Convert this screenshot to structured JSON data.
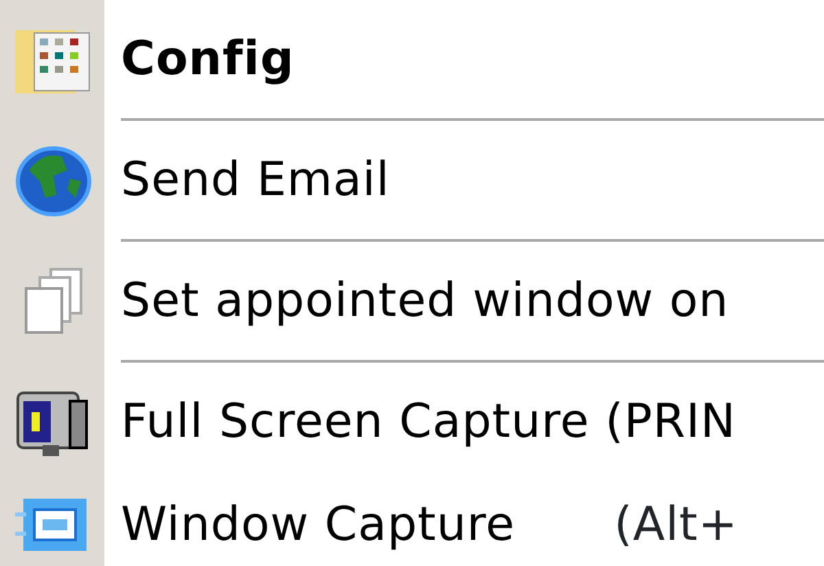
{
  "menu": {
    "items": [
      {
        "kind": "item",
        "label": "Config",
        "bold": true
      },
      {
        "kind": "separator"
      },
      {
        "kind": "item",
        "label": "Send Email",
        "bold": false
      },
      {
        "kind": "separator"
      },
      {
        "kind": "item",
        "label": "Set appointed window on",
        "bold": false
      },
      {
        "kind": "separator"
      },
      {
        "kind": "item",
        "label": "Full Screen Capture (PRIN",
        "bold": false
      },
      {
        "kind": "item",
        "label": "Window Capture",
        "shortcut": "(Alt+",
        "bold": false
      }
    ]
  }
}
